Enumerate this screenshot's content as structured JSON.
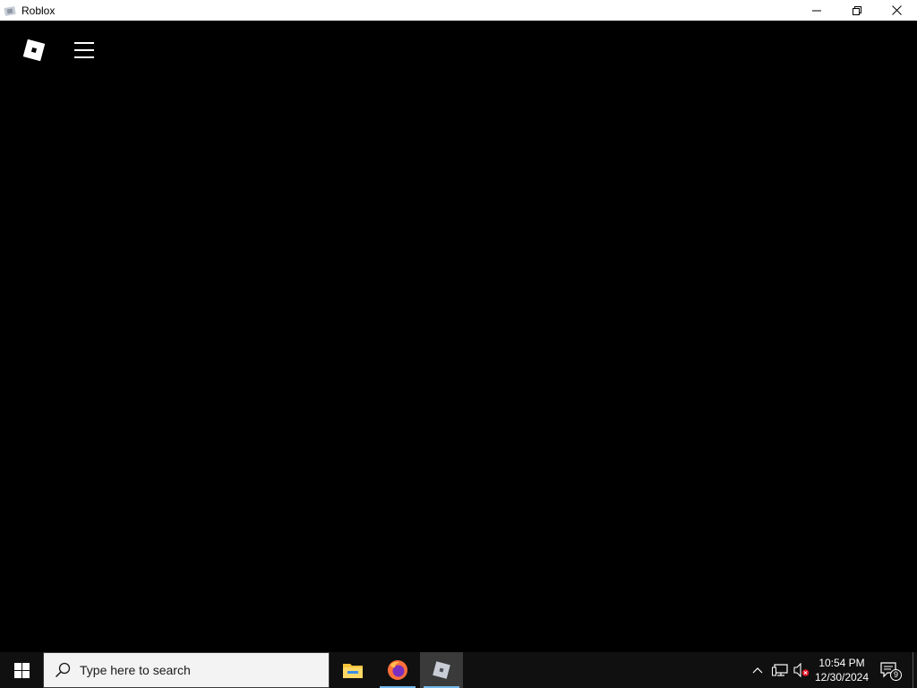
{
  "window": {
    "title": "Roblox",
    "controls": {
      "minimize": "minimize",
      "restore": "restore",
      "close": "close"
    }
  },
  "app": {
    "logo": "roblox-logo",
    "menu_icon": "hamburger-menu-icon",
    "background": "#000000"
  },
  "taskbar": {
    "start_icon": "windows-logo-icon",
    "search": {
      "placeholder": "Type here to search"
    },
    "pinned": [
      {
        "name": "File Explorer",
        "icon": "folder-icon",
        "running": false
      },
      {
        "name": "Firefox",
        "icon": "firefox-icon",
        "running": true
      },
      {
        "name": "Roblox",
        "icon": "roblox-icon",
        "running": true,
        "active": true
      }
    ],
    "tray": {
      "chevron": "chevron-up-icon",
      "network": "network-icon",
      "volume": "volume-muted-icon",
      "time": "10:54 PM",
      "date": "12/30/2024",
      "notifications": "9"
    }
  },
  "colors": {
    "taskbar_bg": "#101010",
    "accent": "#76b9ed",
    "firefox_orange": "#ff7139",
    "folder_yellow": "#f8c33a"
  }
}
